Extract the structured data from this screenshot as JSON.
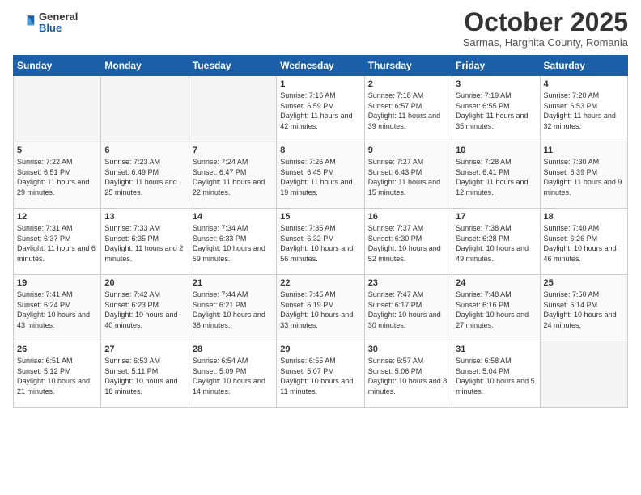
{
  "logo": {
    "general": "General",
    "blue": "Blue"
  },
  "title": "October 2025",
  "subtitle": "Sarmas, Harghita County, Romania",
  "days_of_week": [
    "Sunday",
    "Monday",
    "Tuesday",
    "Wednesday",
    "Thursday",
    "Friday",
    "Saturday"
  ],
  "weeks": [
    [
      {
        "day": "",
        "info": "",
        "empty": true
      },
      {
        "day": "",
        "info": "",
        "empty": true
      },
      {
        "day": "",
        "info": "",
        "empty": true
      },
      {
        "day": "1",
        "info": "Sunrise: 7:16 AM\nSunset: 6:59 PM\nDaylight: 11 hours and 42 minutes.",
        "empty": false
      },
      {
        "day": "2",
        "info": "Sunrise: 7:18 AM\nSunset: 6:57 PM\nDaylight: 11 hours and 39 minutes.",
        "empty": false
      },
      {
        "day": "3",
        "info": "Sunrise: 7:19 AM\nSunset: 6:55 PM\nDaylight: 11 hours and 35 minutes.",
        "empty": false
      },
      {
        "day": "4",
        "info": "Sunrise: 7:20 AM\nSunset: 6:53 PM\nDaylight: 11 hours and 32 minutes.",
        "empty": false
      }
    ],
    [
      {
        "day": "5",
        "info": "Sunrise: 7:22 AM\nSunset: 6:51 PM\nDaylight: 11 hours and 29 minutes.",
        "empty": false
      },
      {
        "day": "6",
        "info": "Sunrise: 7:23 AM\nSunset: 6:49 PM\nDaylight: 11 hours and 25 minutes.",
        "empty": false
      },
      {
        "day": "7",
        "info": "Sunrise: 7:24 AM\nSunset: 6:47 PM\nDaylight: 11 hours and 22 minutes.",
        "empty": false
      },
      {
        "day": "8",
        "info": "Sunrise: 7:26 AM\nSunset: 6:45 PM\nDaylight: 11 hours and 19 minutes.",
        "empty": false
      },
      {
        "day": "9",
        "info": "Sunrise: 7:27 AM\nSunset: 6:43 PM\nDaylight: 11 hours and 15 minutes.",
        "empty": false
      },
      {
        "day": "10",
        "info": "Sunrise: 7:28 AM\nSunset: 6:41 PM\nDaylight: 11 hours and 12 minutes.",
        "empty": false
      },
      {
        "day": "11",
        "info": "Sunrise: 7:30 AM\nSunset: 6:39 PM\nDaylight: 11 hours and 9 minutes.",
        "empty": false
      }
    ],
    [
      {
        "day": "12",
        "info": "Sunrise: 7:31 AM\nSunset: 6:37 PM\nDaylight: 11 hours and 6 minutes.",
        "empty": false
      },
      {
        "day": "13",
        "info": "Sunrise: 7:33 AM\nSunset: 6:35 PM\nDaylight: 11 hours and 2 minutes.",
        "empty": false
      },
      {
        "day": "14",
        "info": "Sunrise: 7:34 AM\nSunset: 6:33 PM\nDaylight: 10 hours and 59 minutes.",
        "empty": false
      },
      {
        "day": "15",
        "info": "Sunrise: 7:35 AM\nSunset: 6:32 PM\nDaylight: 10 hours and 56 minutes.",
        "empty": false
      },
      {
        "day": "16",
        "info": "Sunrise: 7:37 AM\nSunset: 6:30 PM\nDaylight: 10 hours and 52 minutes.",
        "empty": false
      },
      {
        "day": "17",
        "info": "Sunrise: 7:38 AM\nSunset: 6:28 PM\nDaylight: 10 hours and 49 minutes.",
        "empty": false
      },
      {
        "day": "18",
        "info": "Sunrise: 7:40 AM\nSunset: 6:26 PM\nDaylight: 10 hours and 46 minutes.",
        "empty": false
      }
    ],
    [
      {
        "day": "19",
        "info": "Sunrise: 7:41 AM\nSunset: 6:24 PM\nDaylight: 10 hours and 43 minutes.",
        "empty": false
      },
      {
        "day": "20",
        "info": "Sunrise: 7:42 AM\nSunset: 6:23 PM\nDaylight: 10 hours and 40 minutes.",
        "empty": false
      },
      {
        "day": "21",
        "info": "Sunrise: 7:44 AM\nSunset: 6:21 PM\nDaylight: 10 hours and 36 minutes.",
        "empty": false
      },
      {
        "day": "22",
        "info": "Sunrise: 7:45 AM\nSunset: 6:19 PM\nDaylight: 10 hours and 33 minutes.",
        "empty": false
      },
      {
        "day": "23",
        "info": "Sunrise: 7:47 AM\nSunset: 6:17 PM\nDaylight: 10 hours and 30 minutes.",
        "empty": false
      },
      {
        "day": "24",
        "info": "Sunrise: 7:48 AM\nSunset: 6:16 PM\nDaylight: 10 hours and 27 minutes.",
        "empty": false
      },
      {
        "day": "25",
        "info": "Sunrise: 7:50 AM\nSunset: 6:14 PM\nDaylight: 10 hours and 24 minutes.",
        "empty": false
      }
    ],
    [
      {
        "day": "26",
        "info": "Sunrise: 6:51 AM\nSunset: 5:12 PM\nDaylight: 10 hours and 21 minutes.",
        "empty": false
      },
      {
        "day": "27",
        "info": "Sunrise: 6:53 AM\nSunset: 5:11 PM\nDaylight: 10 hours and 18 minutes.",
        "empty": false
      },
      {
        "day": "28",
        "info": "Sunrise: 6:54 AM\nSunset: 5:09 PM\nDaylight: 10 hours and 14 minutes.",
        "empty": false
      },
      {
        "day": "29",
        "info": "Sunrise: 6:55 AM\nSunset: 5:07 PM\nDaylight: 10 hours and 11 minutes.",
        "empty": false
      },
      {
        "day": "30",
        "info": "Sunrise: 6:57 AM\nSunset: 5:06 PM\nDaylight: 10 hours and 8 minutes.",
        "empty": false
      },
      {
        "day": "31",
        "info": "Sunrise: 6:58 AM\nSunset: 5:04 PM\nDaylight: 10 hours and 5 minutes.",
        "empty": false
      },
      {
        "day": "",
        "info": "",
        "empty": true
      }
    ]
  ]
}
